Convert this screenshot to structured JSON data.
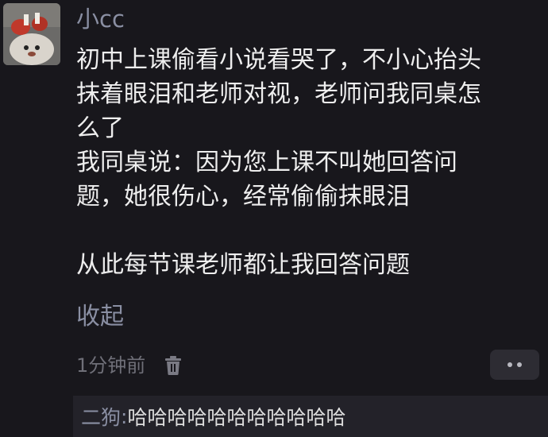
{
  "comment": {
    "username": "小cc",
    "body_lines": [
      "初中上课偷看小说看哭了，不小心抬头",
      "抹着眼泪和老师对视，老师问我同桌怎",
      "么了",
      "我同桌说：因为您上课不叫她回答问",
      "题，她很伤心，经常偷偷抹眼泪",
      "",
      "从此每节课老师都让我回答问题"
    ],
    "collapse_label": "收起",
    "timestamp": "1分钟前",
    "delete_icon": "trash-icon",
    "more_icon": "more-dots-icon"
  },
  "reply": {
    "author": "二狗",
    "separator": ": ",
    "text": "哈哈哈哈哈哈哈哈哈哈哈"
  },
  "colors": {
    "background": "#18171c",
    "muted_text": "#8a8fa3",
    "body_text": "#eeeeee",
    "reply_background": "#232229",
    "button_background": "#2d2c33"
  }
}
